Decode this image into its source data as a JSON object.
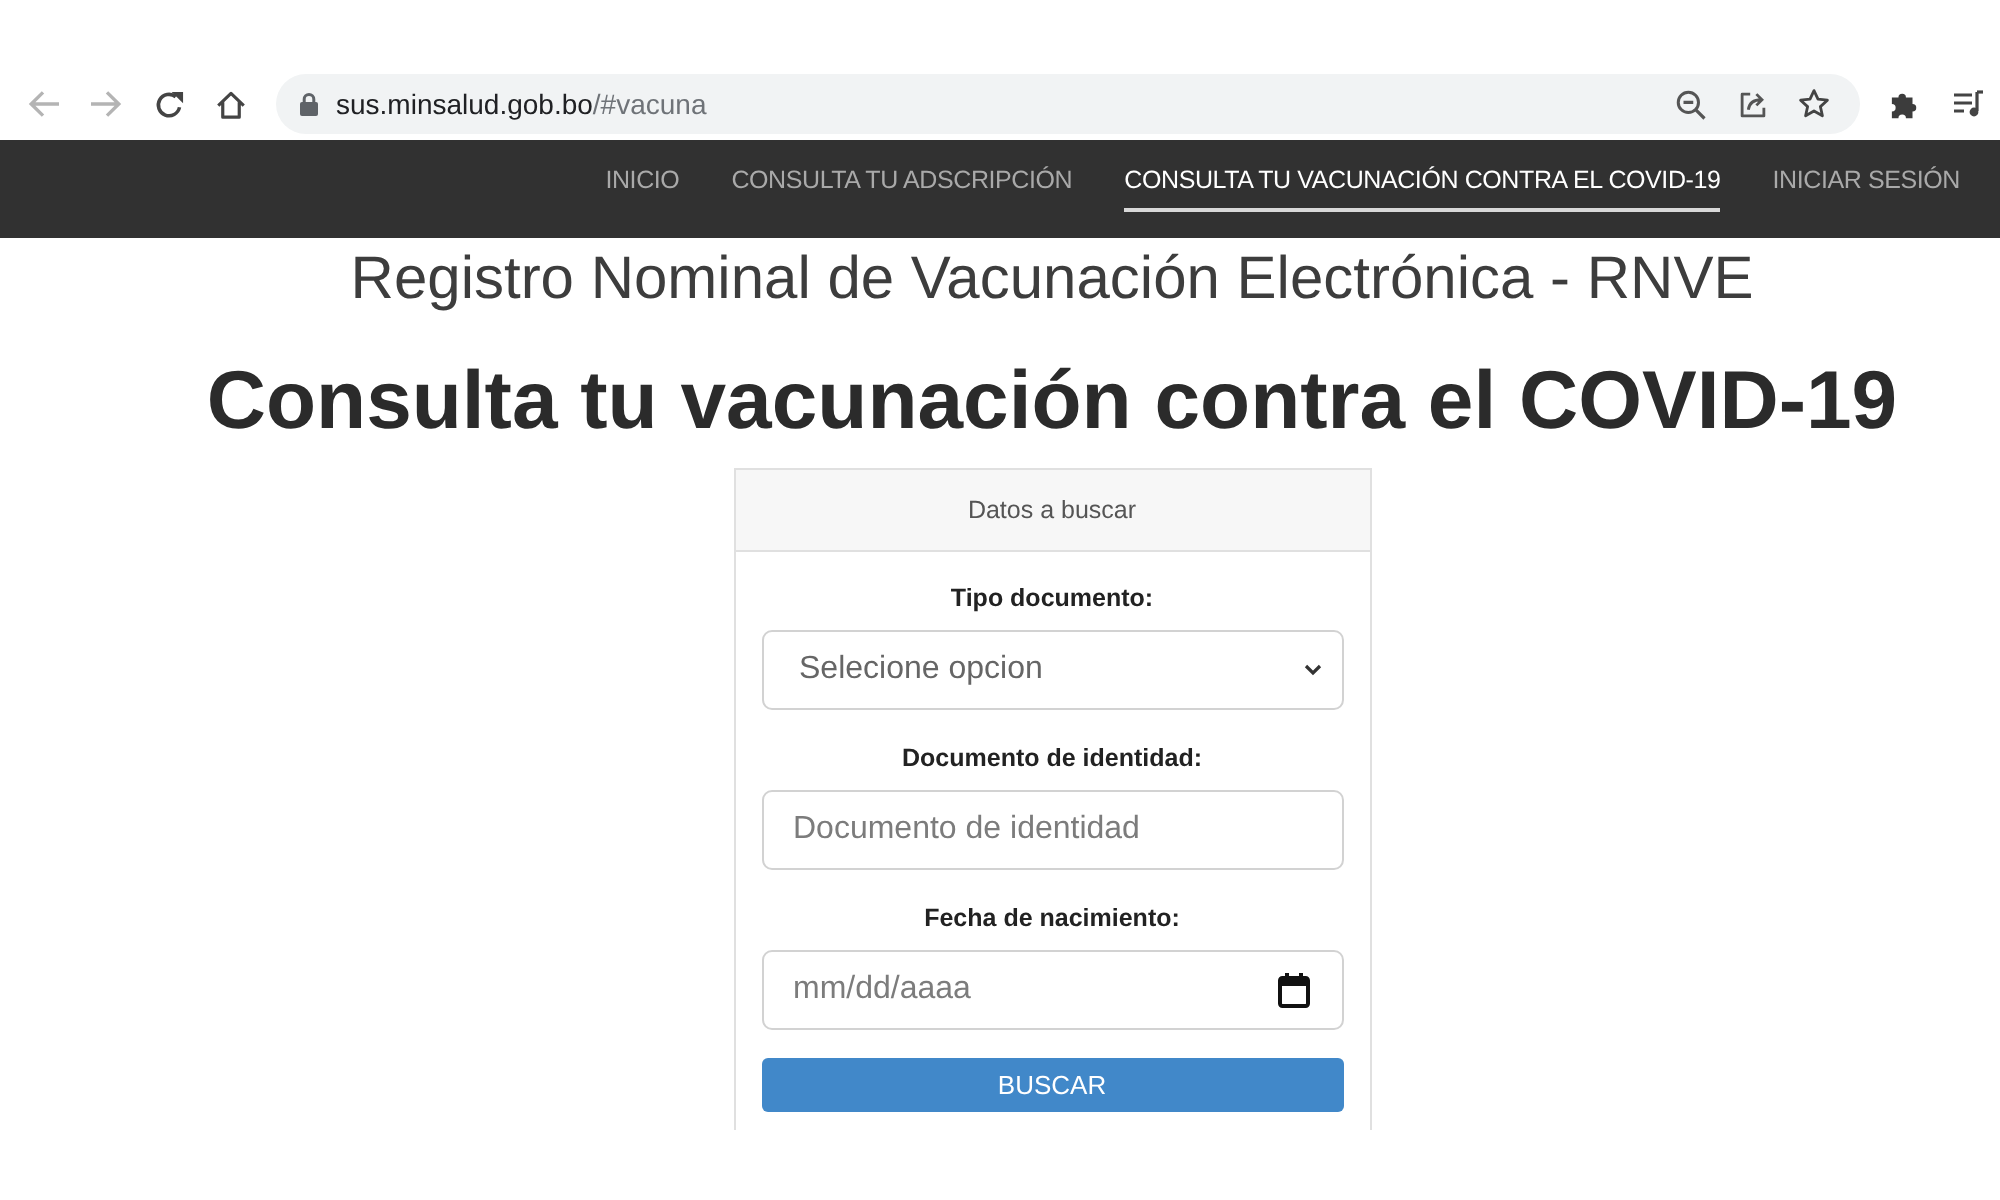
{
  "browser": {
    "address": {
      "host": "sus.minsalud.gob.bo",
      "path": "/#vacuna"
    }
  },
  "navbar": {
    "items": [
      {
        "label": "INICIO",
        "selected": false
      },
      {
        "label": "CONSULTA TU ADSCRIPCIÓN",
        "selected": false
      },
      {
        "label": "CONSULTA TU VACUNACIÓN CONTRA EL COVID-19",
        "selected": true
      },
      {
        "label": "INICIAR SESIÓN",
        "selected": false
      }
    ]
  },
  "page": {
    "subtitle": "Registro Nominal de Vacunación Electrónica - RNVE",
    "title": "Consulta tu vacunación contra el COVID-19"
  },
  "form": {
    "header": "Datos a buscar",
    "fields": [
      {
        "kind": "select",
        "label": "Tipo documento:",
        "value": "Selecione opcion"
      },
      {
        "kind": "text",
        "label": "Documento de identidad:",
        "placeholder": "Documento de identidad"
      },
      {
        "kind": "date",
        "label": "Fecha de nacimiento:",
        "placeholder": "mm/dd/aaaa"
      }
    ],
    "button": "BUSCAR"
  }
}
